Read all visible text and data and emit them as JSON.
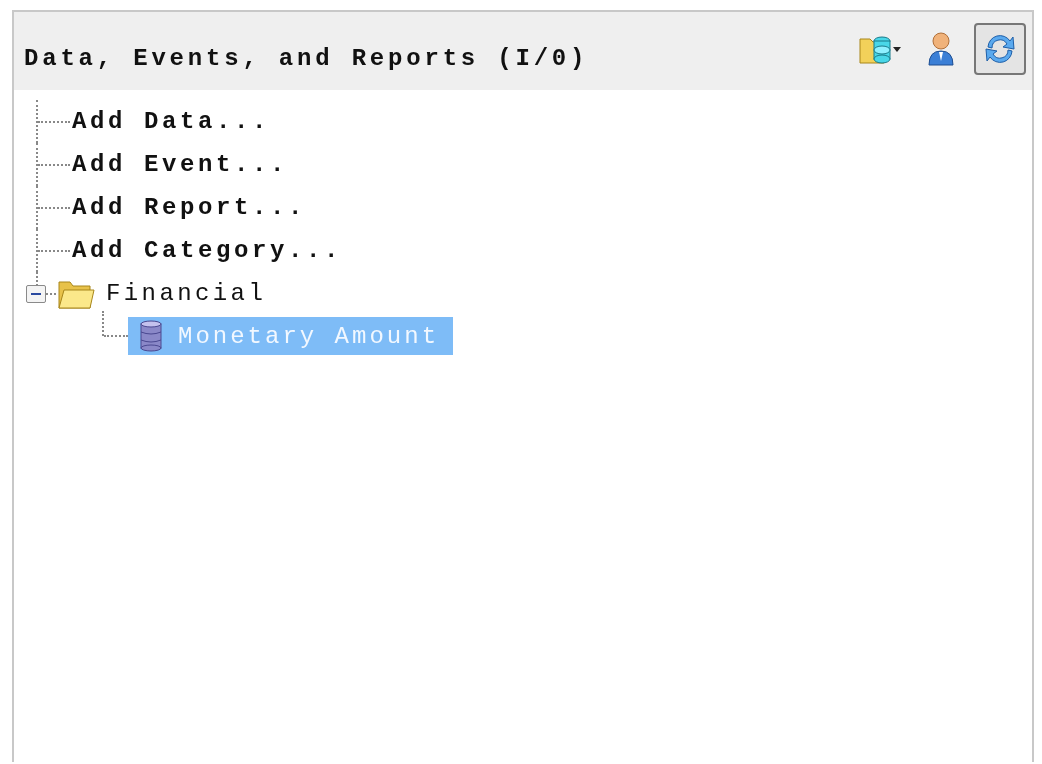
{
  "panel": {
    "title": "Data, Events, and Reports (I/0)",
    "toolbar": [
      {
        "kind": "folder-db",
        "has_menu": true,
        "pressed": false
      },
      {
        "kind": "person",
        "has_menu": false,
        "pressed": false
      },
      {
        "kind": "refresh",
        "has_menu": false,
        "pressed": true
      }
    ]
  },
  "tree": [
    {
      "kind": "action",
      "label": "Add Data..."
    },
    {
      "kind": "action",
      "label": "Add Event..."
    },
    {
      "kind": "action",
      "label": "Add Report..."
    },
    {
      "kind": "action",
      "label": "Add Category..."
    },
    {
      "kind": "folder",
      "label": "Financial",
      "expanded": true,
      "children": [
        {
          "kind": "data",
          "label": "Monetary Amount",
          "selected": true
        }
      ]
    }
  ]
}
